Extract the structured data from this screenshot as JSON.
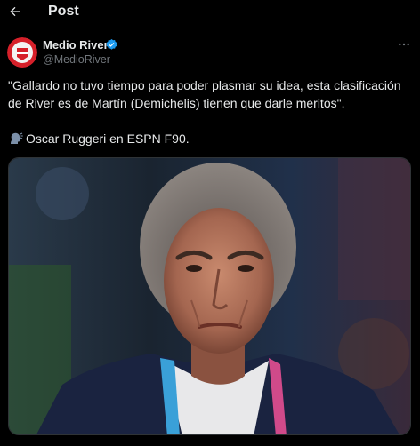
{
  "header": {
    "back_icon": "arrow-left-icon",
    "title": "Post"
  },
  "author": {
    "name": "Medio River",
    "handle": "@MedioRiver",
    "verified_icon": "verified-badge-icon",
    "verified_color": "#1d9bf0",
    "avatar_color": "#d6202a"
  },
  "tweet": {
    "line1": "\"Gallardo no tuvo tiempo para poder plasmar su idea, esta clasificación de River es de Martín (Demichelis) tienen que darle meritos\".",
    "line2": "Oscar Ruggeri en ESPN F90.",
    "line2_icon": "speaking-head-icon"
  },
  "media": {
    "icon": "photo-man-portrait"
  },
  "colors": {
    "background": "#000000",
    "text": "#e7e9ea",
    "secondary": "#71767b",
    "border": "#2f3336"
  }
}
